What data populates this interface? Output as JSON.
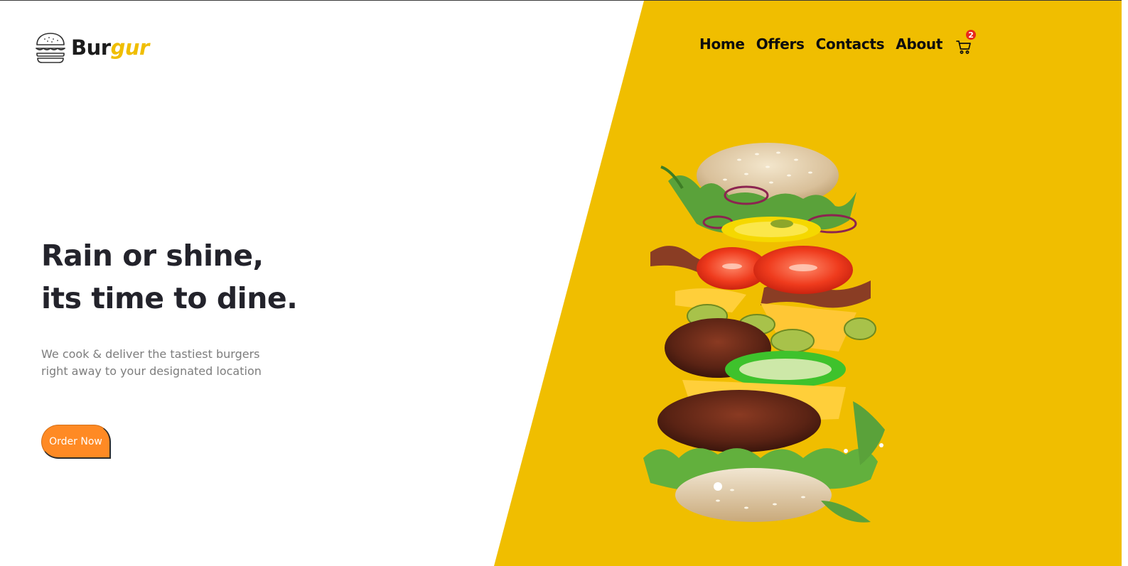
{
  "brand": {
    "part1": "Bur",
    "part2": "gur",
    "icon": "burger-logo-icon"
  },
  "nav": {
    "items": [
      {
        "label": "Home"
      },
      {
        "label": "Offers"
      },
      {
        "label": "Contacts"
      },
      {
        "label": "About"
      }
    ],
    "cart": {
      "icon": "cart-icon",
      "count": "2"
    }
  },
  "hero": {
    "headline_line1": "Rain or shine,",
    "headline_line2": "its time to dine.",
    "subtext_line1": "We cook & deliver the tastiest burgers",
    "subtext_line2": "right away to your designated location",
    "cta_label": "Order Now"
  },
  "colors": {
    "accent_yellow": "#f0be00",
    "cta_orange": "#ff8a24",
    "badge_red": "#e8291c",
    "heading_dark": "#23232b"
  }
}
